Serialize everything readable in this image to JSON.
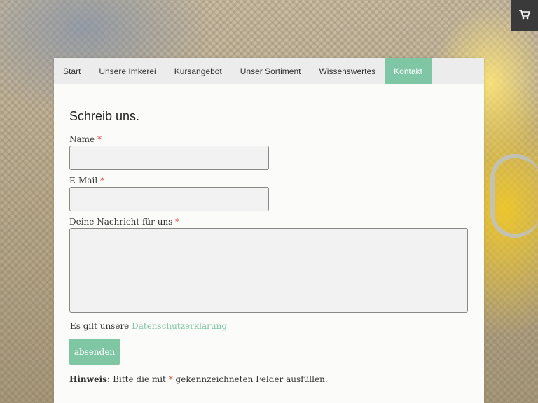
{
  "cart": {
    "icon": "shopping-cart-icon"
  },
  "nav": {
    "items": [
      {
        "label": "Start"
      },
      {
        "label": "Unsere Imkerei"
      },
      {
        "label": "Kursangebot"
      },
      {
        "label": "Unser Sortiment"
      },
      {
        "label": "Wissenswertes"
      },
      {
        "label": "Kontakt",
        "active": true
      }
    ]
  },
  "form": {
    "heading": "Schreib uns.",
    "required_marker": "*",
    "name_label": "Name",
    "name_value": "",
    "email_label": "E-Mail",
    "email_value": "",
    "message_label": "Deine Nachricht für uns",
    "message_value": "",
    "privacy_text": "Es gilt unsere",
    "privacy_link": "Datenschutzerklärung",
    "submit_label": "absenden",
    "hint_bold": "Hinweis:",
    "hint_before": "Bitte die mit",
    "hint_after": "gekennzeichneten Felder ausfüllen."
  },
  "colors": {
    "accent": "#7fc6a4",
    "required": "#d9534f"
  }
}
